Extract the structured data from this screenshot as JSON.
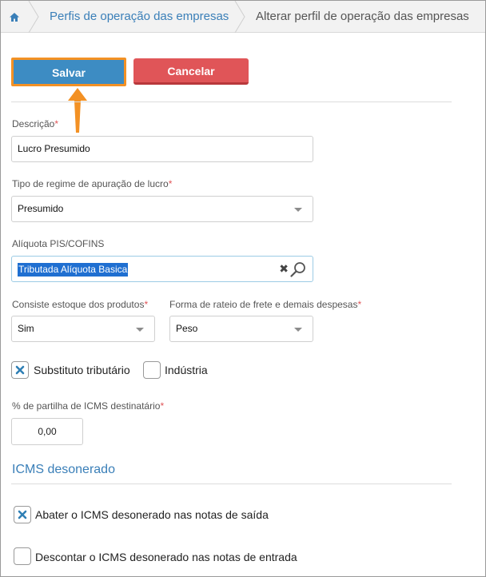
{
  "breadcrumb": {
    "items": [
      {
        "label": "Perfis de operação das empresas"
      },
      {
        "label": "Alterar perfil de operação das empresas"
      }
    ]
  },
  "actions": {
    "save_label": "Salvar",
    "cancel_label": "Cancelar"
  },
  "form": {
    "descricao": {
      "label": "Descrição",
      "required_mark": "*",
      "value": "Lucro Presumido"
    },
    "regime": {
      "label": "Tipo de regime de apuração de lucro",
      "required_mark": "*",
      "value": "Presumido"
    },
    "aliquota": {
      "label": "Alíquota PIS/COFINS",
      "value": "Tributada Alíquota Basica"
    },
    "estoque": {
      "label": "Consiste estoque dos produtos",
      "required_mark": "*",
      "value": "Sim"
    },
    "rateio": {
      "label": "Forma de rateio de frete e demais despesas",
      "required_mark": "*",
      "value": "Peso"
    },
    "substituto": {
      "label": "Substituto tributário",
      "checked": true
    },
    "industria": {
      "label": "Indústria",
      "checked": false
    },
    "partilha": {
      "label": "% de partilha de ICMS destinatário",
      "required_mark": "*",
      "value": "0,00"
    }
  },
  "icms_section": {
    "title": "ICMS desonerado",
    "abater": {
      "label": "Abater o ICMS desonerado nas notas de saída",
      "checked": true
    },
    "descontar": {
      "label": "Descontar o ICMS desonerado nas notas de entrada",
      "checked": false
    }
  },
  "colors": {
    "accent": "#3a7fb8",
    "save": "#3d8cc3",
    "cancel": "#e05558",
    "highlight": "#f39124"
  }
}
